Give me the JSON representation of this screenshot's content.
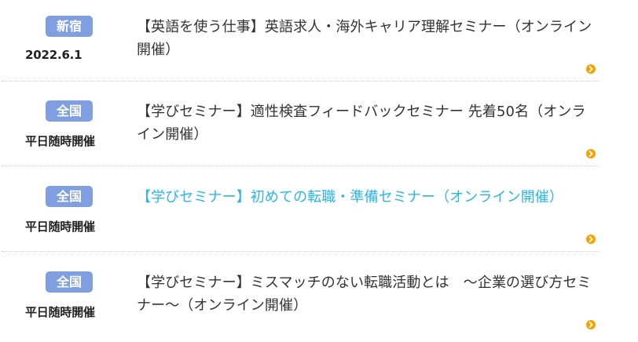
{
  "seminars": [
    {
      "badge": "新宿",
      "schedule": "2022.6.1",
      "title": "【英語を使う仕事】英語求人・海外キャリア理解セミナー（オンライン開催）",
      "arrow_icon": "chevron-right-icon"
    },
    {
      "badge": "全国",
      "schedule": "平日随時開催",
      "title": "【学びセミナー】適性検査フィードバックセミナー 先着50名（オンライン開催）",
      "arrow_icon": "chevron-right-icon"
    },
    {
      "badge": "全国",
      "schedule": "平日随時開催",
      "title": "【学びセミナー】初めての転職・準備セミナー（オンライン開催）",
      "arrow_icon": "chevron-right-icon"
    },
    {
      "badge": "全国",
      "schedule": "平日随時開催",
      "title": "【学びセミナー】ミスマッチのない転職活動とは　～企業の選び方セミナー～（オンライン開催）",
      "arrow_icon": "chevron-right-icon"
    }
  ],
  "colors": {
    "badge_bg": "#7f9fe1",
    "link_active": "#29b6e9",
    "arrow": "#f5a200",
    "text": "#333333"
  }
}
